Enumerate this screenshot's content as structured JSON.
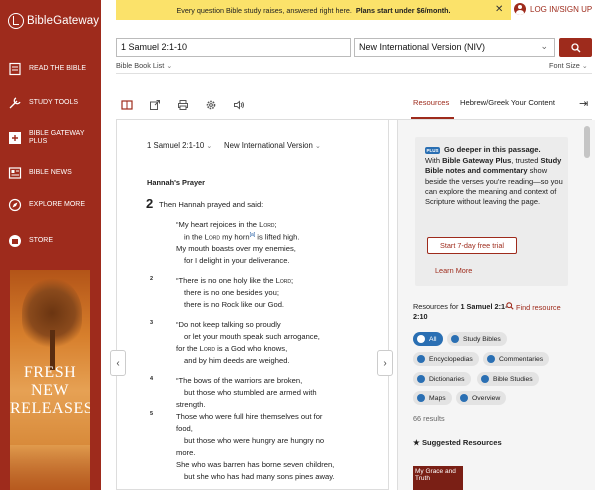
{
  "app": {
    "logo": "BibleGateway"
  },
  "sidebar": {
    "items": [
      {
        "label": "READ THE BIBLE",
        "icon": "book-icon"
      },
      {
        "label": "STUDY TOOLS",
        "icon": "tools-icon"
      },
      {
        "label": "BIBLE GATEWAY PLUS",
        "icon": "plus-icon"
      },
      {
        "label": "BIBLE NEWS",
        "icon": "news-icon"
      },
      {
        "label": "EXPLORE MORE",
        "icon": "compass-icon"
      },
      {
        "label": "STORE",
        "icon": "store-icon"
      }
    ],
    "ad": {
      "line1": "FRESH",
      "line2": "NEW",
      "line3": "RELEASES"
    }
  },
  "promo": {
    "text": "Every question Bible study raises, answered right here.",
    "bold": "Plans start under $6/month."
  },
  "login": "LOG IN/SIGN UP",
  "search": {
    "passage": "1 Samuel 2:1-10",
    "version": "New International Version (NIV)"
  },
  "booklist": "Bible Book List",
  "fontsize": "Font Size",
  "tabs": {
    "resources": "Resources",
    "hebrew": "Hebrew/Greek Your Content"
  },
  "reader": {
    "ref": "1 Samuel 2:1-10",
    "version": "New International Version",
    "heading": "Hannah's Prayer",
    "chapter": "2",
    "intro": "Then Hannah prayed and said:"
  },
  "resources": {
    "plus_badge": "PLUS",
    "plus_title": "Go deeper in this passage.",
    "plus_body_1": "With",
    "plus_body_bold1": "Bible Gateway Plus",
    "plus_body_2": ", trusted",
    "plus_body_bold2": "Study Bible notes and commentary",
    "plus_body_3": "show beside the verses you're reading—so you can explore the meaning and context of Scripture without leaving the page.",
    "trial": "Start 7-day free trial",
    "learn": "Learn More",
    "for_label": "Resources for",
    "for_ref": "1 Samuel 2:1-2:10",
    "find": "Find resource",
    "chips": [
      "All",
      "Study Bibles",
      "Encyclopedias",
      "Commentaries",
      "Dictionaries",
      "Bible Studies",
      "Maps",
      "Overview"
    ],
    "count": "66 results",
    "suggested": "Suggested Resources",
    "thumb": "My Grace and Truth"
  }
}
